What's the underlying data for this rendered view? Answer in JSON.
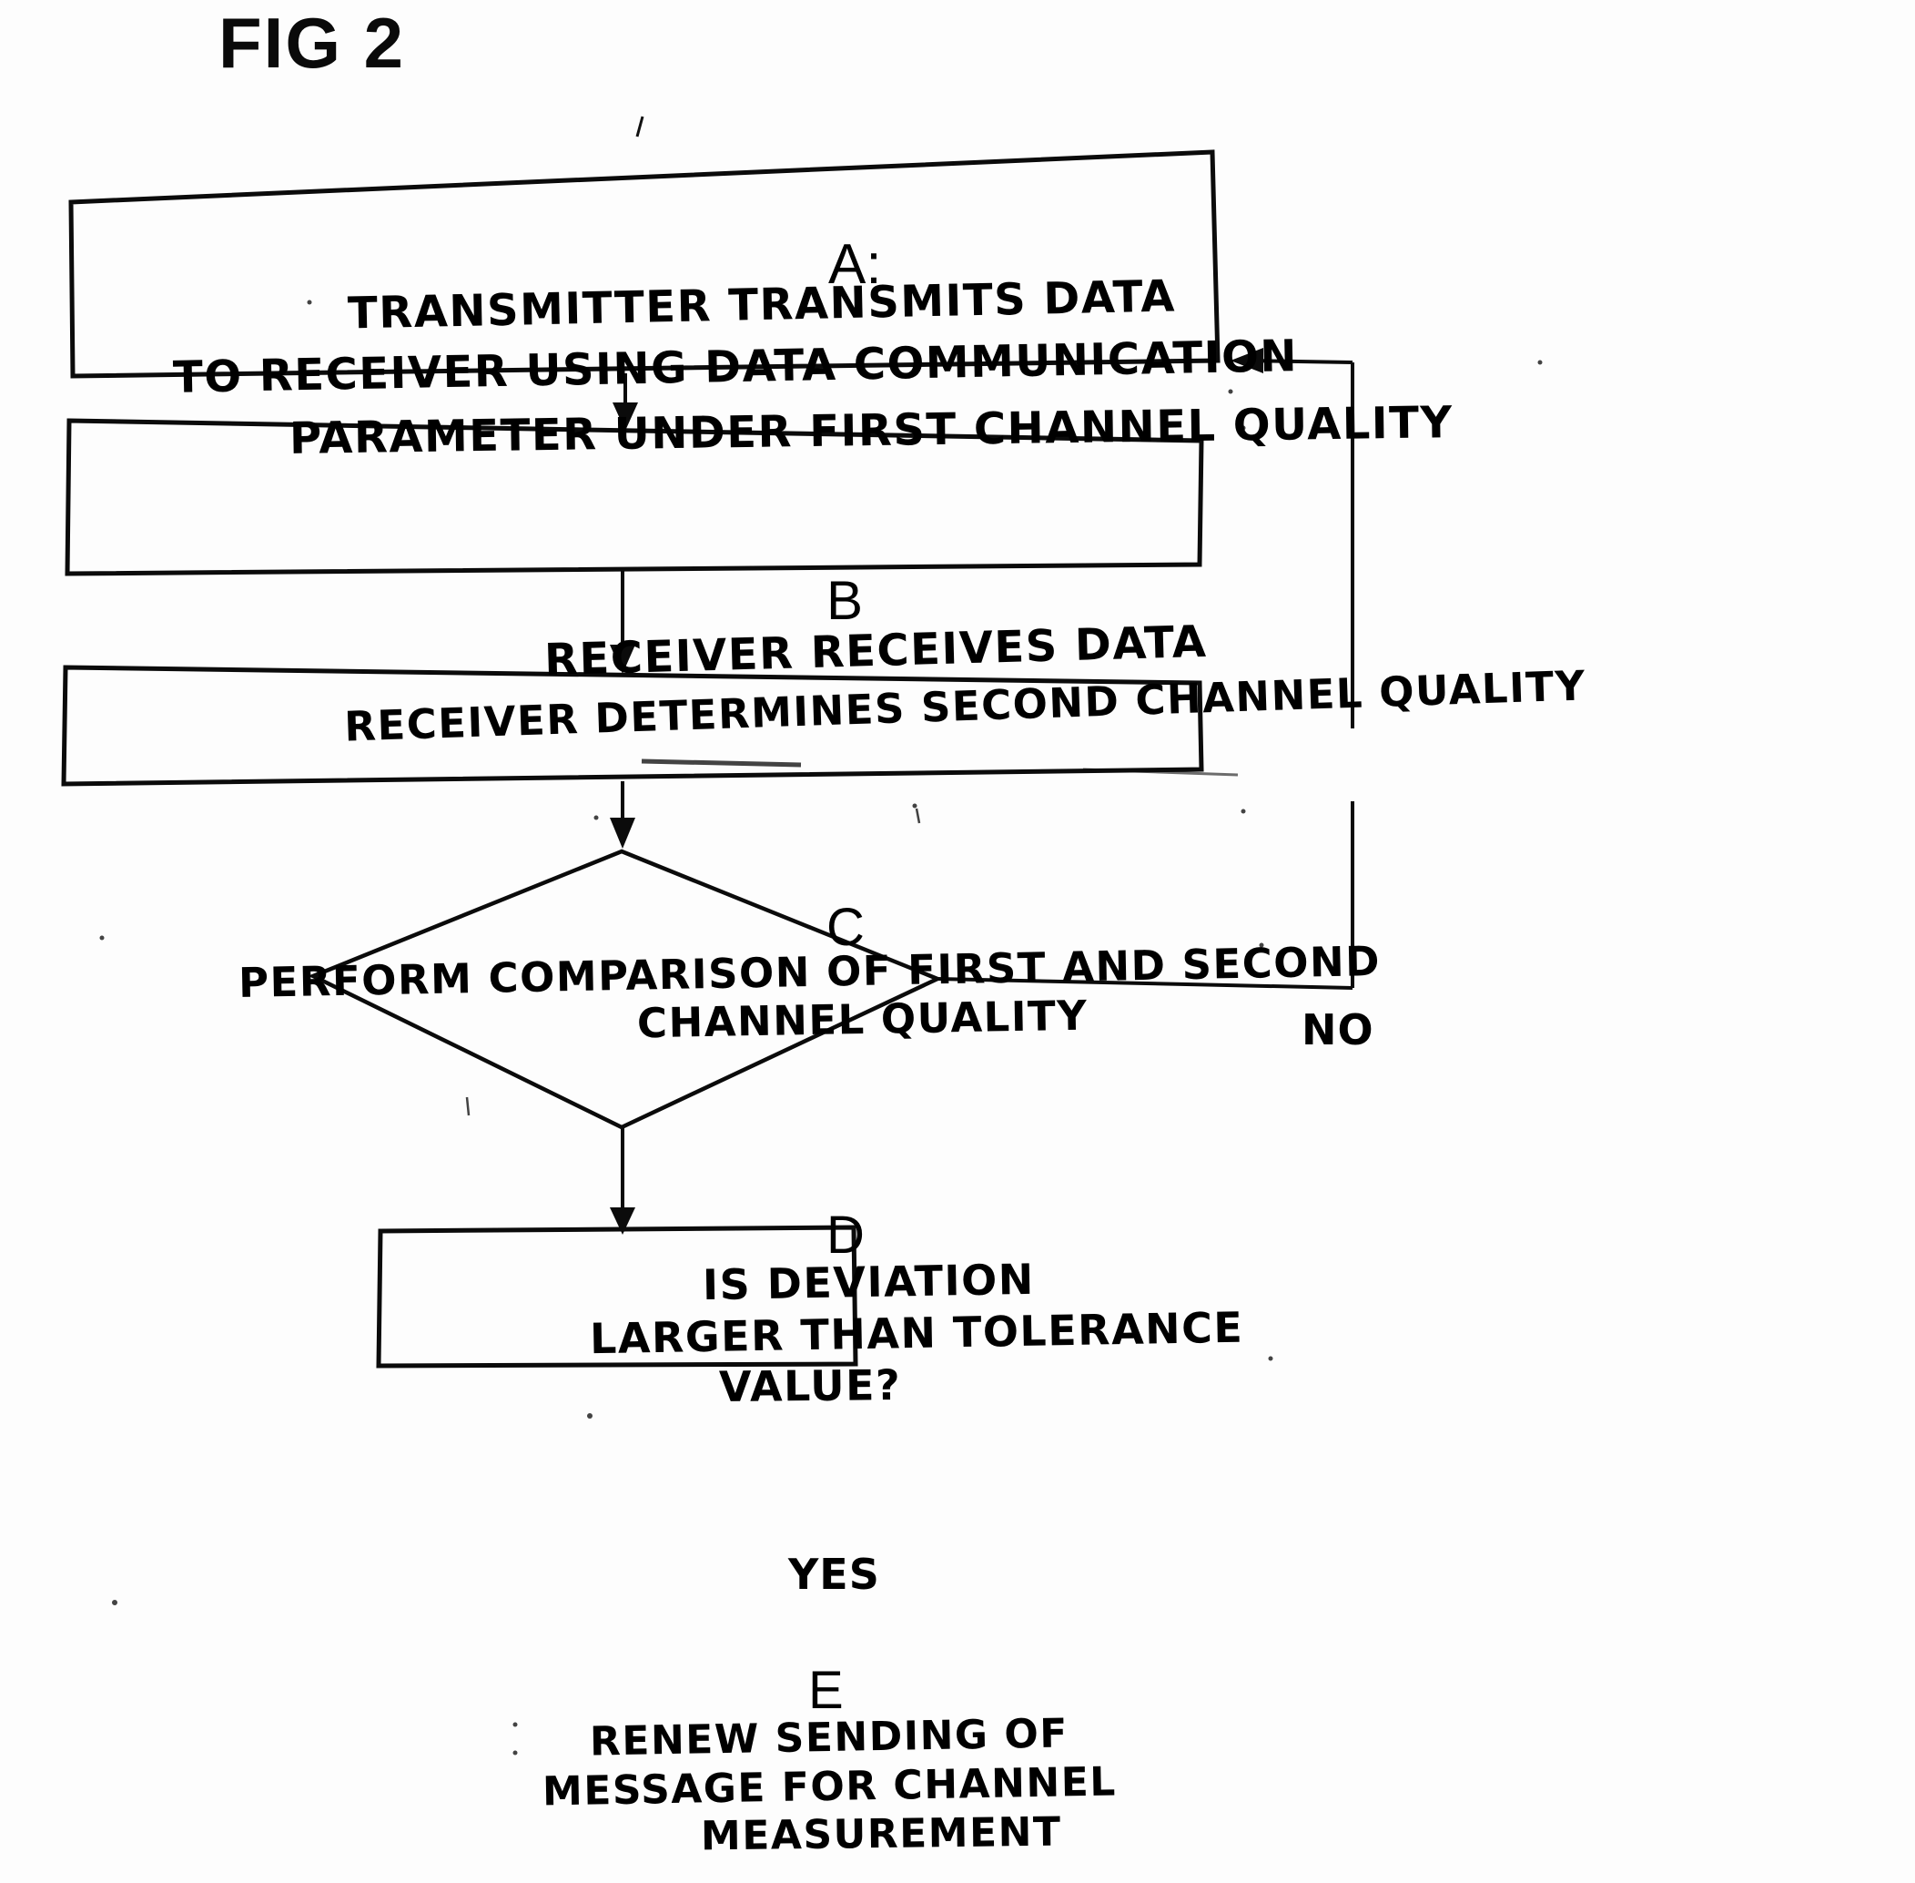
{
  "figure": {
    "title": "FIG 2",
    "kind": "patent-flowchart",
    "ink_color": "#000000",
    "paper_color": "#fdfdfd"
  },
  "nodes": {
    "a": {
      "letter": "A:",
      "shape": "rectangle",
      "lines": [
        "TRANSMITTER  TRANSMITS   DATA",
        "TO RECEIVER USING  DATA   COMMUNICATION",
        "PARAMETER UNDER  FIRST CHANNEL QUALITY"
      ]
    },
    "b": {
      "letter": "B",
      "shape": "rectangle",
      "lines": [
        "RECEIVER   RECEIVES  DATA",
        "RECEIVER DETERMINES  SECOND CHANNEL QUALITY"
      ]
    },
    "c": {
      "letter": "C",
      "shape": "rectangle",
      "lines": [
        "PERFORM   COMPARISON OF  FIRST AND  SECOND",
        "CHANNEL  QUALITY"
      ]
    },
    "d": {
      "letter": "D",
      "shape": "diamond",
      "lines": [
        "IS   DEVIATION",
        "LARGER  THAN TOLERANCE",
        "VALUE?"
      ]
    },
    "e": {
      "letter": "E",
      "shape": "rectangle",
      "lines": [
        "RENEW SENDING OF",
        "MESSAGE FOR   CHANNEL",
        "MEASUREMENT"
      ]
    }
  },
  "edges": {
    "a_to_b": {
      "label": "",
      "direction": "down"
    },
    "b_to_c": {
      "label": "",
      "direction": "down"
    },
    "c_to_d": {
      "label": "",
      "direction": "down"
    },
    "d_to_e": {
      "label": "YES",
      "direction": "down"
    },
    "d_to_a": {
      "label": "NO",
      "direction": "right-up-left"
    }
  }
}
